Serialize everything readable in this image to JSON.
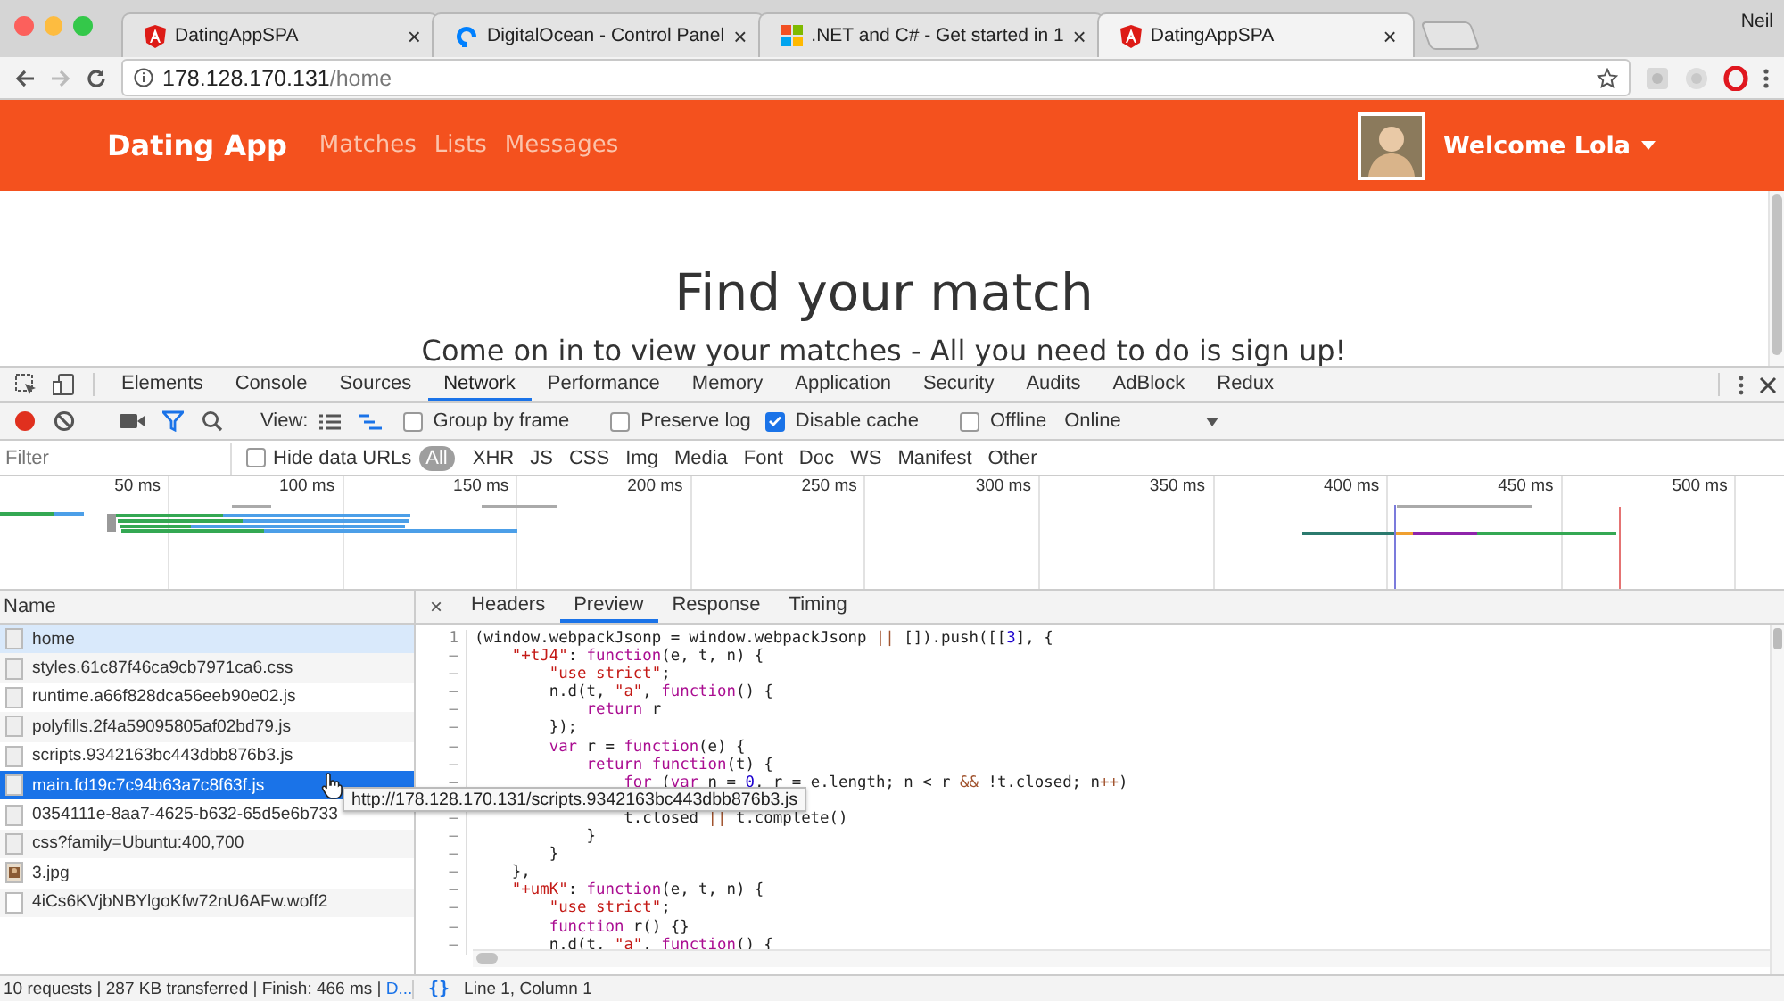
{
  "browser": {
    "tabs": [
      {
        "title": "DatingAppSPA",
        "kind": "angular",
        "close": "×",
        "selected": false
      },
      {
        "title": "DigitalOcean - Control Panel",
        "kind": "digitalocean",
        "close": "×",
        "selected": false
      },
      {
        "title": ".NET and C# - Get started in 1",
        "kind": "windows",
        "close": "×",
        "selected": false
      },
      {
        "title": "DatingAppSPA",
        "kind": "angular",
        "close": "×",
        "selected": true
      }
    ],
    "profile": "Neil",
    "address": {
      "host": "178.128.170.131",
      "path": "/home"
    }
  },
  "navbar": {
    "brand": "Dating App",
    "links": [
      "Matches",
      "Lists",
      "Messages"
    ],
    "welcome": "Welcome Lola"
  },
  "hero": {
    "title": "Find your match",
    "subtitle": "Come on in to view your matches - All you need to do is sign up!"
  },
  "devtools": {
    "tabs": [
      {
        "label": "Elements",
        "selected": false
      },
      {
        "label": "Console",
        "selected": false
      },
      {
        "label": "Sources",
        "selected": false
      },
      {
        "label": "Network",
        "selected": true
      },
      {
        "label": "Performance",
        "selected": false
      },
      {
        "label": "Memory",
        "selected": false
      },
      {
        "label": "Application",
        "selected": false
      },
      {
        "label": "Security",
        "selected": false
      },
      {
        "label": "Audits",
        "selected": false
      },
      {
        "label": "AdBlock",
        "selected": false
      },
      {
        "label": "Redux",
        "selected": false
      }
    ],
    "toolbar": {
      "view_label": "View:",
      "checkboxes": [
        {
          "label": "Group by frame",
          "checked": false
        },
        {
          "label": "Preserve log",
          "checked": false
        },
        {
          "label": "Disable cache",
          "checked": true
        },
        {
          "label": "Offline",
          "checked": false
        }
      ],
      "throttle": "Online"
    },
    "filter": {
      "placeholder": "Filter",
      "hide_data_urls": {
        "label": "Hide data URLs",
        "checked": false
      },
      "types": [
        {
          "label": "All",
          "selected": true
        },
        {
          "label": "XHR",
          "selected": false
        },
        {
          "label": "JS",
          "selected": false
        },
        {
          "label": "CSS",
          "selected": false
        },
        {
          "label": "Img",
          "selected": false
        },
        {
          "label": "Media",
          "selected": false
        },
        {
          "label": "Font",
          "selected": false
        },
        {
          "label": "Doc",
          "selected": false
        },
        {
          "label": "WS",
          "selected": false
        },
        {
          "label": "Manifest",
          "selected": false
        },
        {
          "label": "Other",
          "selected": false
        }
      ]
    },
    "timeline": {
      "ticks": [
        "50 ms",
        "100 ms",
        "150 ms",
        "200 ms",
        "250 ms",
        "300 ms",
        "350 ms",
        "400 ms",
        "450 ms",
        "500 ms"
      ]
    },
    "requests": {
      "header": "Name",
      "rows": [
        {
          "name": "home",
          "kind": "document",
          "selected": false,
          "highlighted": true
        },
        {
          "name": "styles.61c87f46ca9cb7971ca6.css",
          "kind": "document",
          "selected": false,
          "highlighted": false
        },
        {
          "name": "runtime.a66f828dca56eeb90e02.js",
          "kind": "document",
          "selected": false,
          "highlighted": false
        },
        {
          "name": "polyfills.2f4a59095805af02bd79.js",
          "kind": "document",
          "selected": false,
          "highlighted": false
        },
        {
          "name": "scripts.9342163bc443dbb876b3.js",
          "kind": "document",
          "selected": false,
          "highlighted": false
        },
        {
          "name": "main.fd19c7c94b63a7c8f63f.js",
          "kind": "document",
          "selected": true,
          "highlighted": false
        },
        {
          "name": "0354111e-8aa7-4625-b632-65d5e6b733",
          "kind": "document",
          "selected": false,
          "highlighted": false
        },
        {
          "name": "css?family=Ubuntu:400,700",
          "kind": "document",
          "selected": false,
          "highlighted": false
        },
        {
          "name": "3.jpg",
          "kind": "image",
          "selected": false,
          "highlighted": false
        },
        {
          "name": "4iCs6KVjbNBYlgoKfw72nU6AFw.woff2",
          "kind": "font",
          "selected": false,
          "highlighted": false
        }
      ]
    },
    "detail": {
      "close": "×",
      "tabs": [
        {
          "label": "Headers",
          "selected": false
        },
        {
          "label": "Preview",
          "selected": true
        },
        {
          "label": "Response",
          "selected": false
        },
        {
          "label": "Timing",
          "selected": false
        }
      ],
      "code": [
        {
          "num": "1",
          "tokens": [
            {
              "text": "(window.webpackJsonp = window.webpackJsonp ",
              "kind": "plain"
            },
            {
              "text": "||",
              "kind": "operator"
            },
            {
              "text": " []).push([[",
              "kind": "plain"
            },
            {
              "text": "3",
              "kind": "number"
            },
            {
              "text": "], {",
              "kind": "plain"
            }
          ]
        },
        {
          "num": "–",
          "tokens": [
            {
              "text": "    \"+tJ4\"",
              "kind": "string"
            },
            {
              "text": ": ",
              "kind": "plain"
            },
            {
              "text": "function",
              "kind": "keyword"
            },
            {
              "text": "(e, t, n) {",
              "kind": "plain"
            }
          ]
        },
        {
          "num": "–",
          "tokens": [
            {
              "text": "        \"use strict\"",
              "kind": "string"
            },
            {
              "text": ";",
              "kind": "plain"
            }
          ]
        },
        {
          "num": "–",
          "tokens": [
            {
              "text": "        n.d(t, ",
              "kind": "plain"
            },
            {
              "text": "\"a\"",
              "kind": "string"
            },
            {
              "text": ", ",
              "kind": "plain"
            },
            {
              "text": "function",
              "kind": "keyword"
            },
            {
              "text": "() {",
              "kind": "plain"
            }
          ]
        },
        {
          "num": "–",
          "tokens": [
            {
              "text": "            return",
              "kind": "keyword"
            },
            {
              "text": " r",
              "kind": "plain"
            }
          ]
        },
        {
          "num": "–",
          "tokens": [
            {
              "text": "        });",
              "kind": "plain"
            }
          ]
        },
        {
          "num": "–",
          "tokens": [
            {
              "text": "        var",
              "kind": "keyword"
            },
            {
              "text": " r = ",
              "kind": "plain"
            },
            {
              "text": "function",
              "kind": "keyword"
            },
            {
              "text": "(e) {",
              "kind": "plain"
            }
          ]
        },
        {
          "num": "–",
          "tokens": [
            {
              "text": "            return",
              "kind": "keyword"
            },
            {
              "text": " function",
              "kind": "keyword"
            },
            {
              "text": "(t) {",
              "kind": "plain"
            }
          ]
        },
        {
          "num": "–",
          "tokens": [
            {
              "text": "                for",
              "kind": "keyword"
            },
            {
              "text": " (",
              "kind": "plain"
            },
            {
              "text": "var",
              "kind": "keyword"
            },
            {
              "text": " n = ",
              "kind": "plain"
            },
            {
              "text": "0",
              "kind": "number"
            },
            {
              "text": ", r = e.length; n < r ",
              "kind": "plain"
            },
            {
              "text": "&&",
              "kind": "operator"
            },
            {
              "text": " !t.closed; n",
              "kind": "plain"
            },
            {
              "text": "++",
              "kind": "operator"
            },
            {
              "text": ")",
              "kind": "plain"
            }
          ]
        },
        {
          "num": "–",
          "gap_before": true,
          "tokens": [
            {
              "text": "                t.closed ",
              "kind": "plain"
            },
            {
              "text": "||",
              "kind": "operator"
            },
            {
              "text": " t.complete()",
              "kind": "plain"
            }
          ]
        },
        {
          "num": "–",
          "tokens": [
            {
              "text": "            }",
              "kind": "plain"
            }
          ]
        },
        {
          "num": "–",
          "tokens": [
            {
              "text": "        }",
              "kind": "plain"
            }
          ]
        },
        {
          "num": "–",
          "tokens": [
            {
              "text": "    },",
              "kind": "plain"
            }
          ]
        },
        {
          "num": "–",
          "tokens": [
            {
              "text": "    \"+umK\"",
              "kind": "string"
            },
            {
              "text": ": ",
              "kind": "plain"
            },
            {
              "text": "function",
              "kind": "keyword"
            },
            {
              "text": "(e, t, n) {",
              "kind": "plain"
            }
          ]
        },
        {
          "num": "–",
          "tokens": [
            {
              "text": "        \"use strict\"",
              "kind": "string"
            },
            {
              "text": ";",
              "kind": "plain"
            }
          ]
        },
        {
          "num": "–",
          "tokens": [
            {
              "text": "        function",
              "kind": "keyword"
            },
            {
              "text": " r() {}",
              "kind": "plain"
            }
          ]
        },
        {
          "num": "–",
          "tokens": [
            {
              "text": "        n.d(t, ",
              "kind": "plain"
            },
            {
              "text": "\"a\"",
              "kind": "string"
            },
            {
              "text": ", ",
              "kind": "plain"
            },
            {
              "text": "function",
              "kind": "keyword"
            },
            {
              "text": "() {",
              "kind": "plain"
            }
          ]
        }
      ]
    },
    "tooltip": "http://178.128.170.131/scripts.9342163bc443dbb876b3.js",
    "status": {
      "summary": "10 requests | 287 KB transferred | Finish: 466 ms | ",
      "link": "D...",
      "format": "{}",
      "position": "Line 1, Column 1"
    }
  }
}
